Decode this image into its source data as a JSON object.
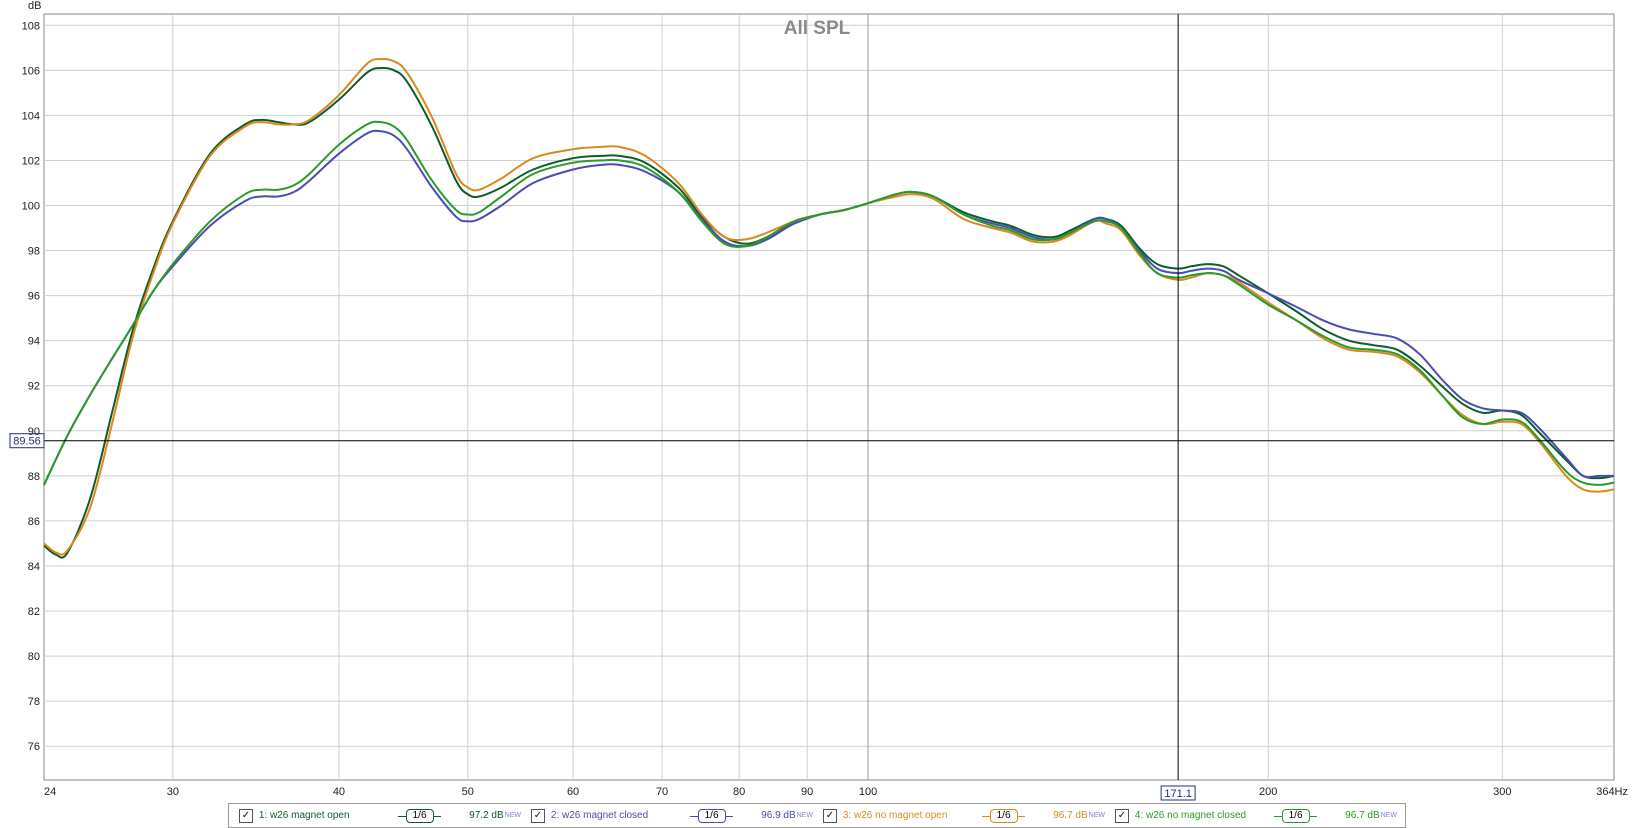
{
  "chart_data": {
    "type": "line",
    "title": "All SPL",
    "xlabel": "Hz",
    "ylabel": "dB",
    "xscale": "log",
    "xlim": [
      24,
      364
    ],
    "ylim": [
      74.5,
      108.5
    ],
    "xticks": [
      24,
      30,
      40,
      50,
      60,
      70,
      80,
      90,
      100,
      200,
      300,
      364
    ],
    "xtick_labels": [
      "24",
      "30",
      "40",
      "50",
      "60",
      "70",
      "80",
      "90",
      "100",
      "200",
      "300",
      "364Hz"
    ],
    "yticks": [
      76,
      78,
      80,
      82,
      84,
      86,
      88,
      90,
      92,
      94,
      96,
      98,
      100,
      102,
      104,
      106,
      108
    ],
    "grid": true,
    "legend_position": "bottom",
    "cursor": {
      "x": 171.1,
      "x_label": "171.1",
      "y": 89.56,
      "y_label": "89.56"
    },
    "series": [
      {
        "name": "1: w26 magnet open",
        "color": "#0d5c2a",
        "points": [
          [
            24,
            84.9
          ],
          [
            24.5,
            84.5
          ],
          [
            25,
            84.6
          ],
          [
            26,
            87
          ],
          [
            27,
            90.8
          ],
          [
            28,
            94.5
          ],
          [
            29,
            97.2
          ],
          [
            30,
            99.3
          ],
          [
            32,
            102.3
          ],
          [
            34,
            103.6
          ],
          [
            35,
            103.8
          ],
          [
            36,
            103.7
          ],
          [
            37,
            103.6
          ],
          [
            38,
            103.7
          ],
          [
            40,
            104.7
          ],
          [
            42,
            105.9
          ],
          [
            43,
            106.1
          ],
          [
            44,
            106.0
          ],
          [
            45,
            105.5
          ],
          [
            47,
            103.5
          ],
          [
            49,
            101.1
          ],
          [
            50,
            100.5
          ],
          [
            51,
            100.4
          ],
          [
            53,
            100.8
          ],
          [
            56,
            101.6
          ],
          [
            60,
            102.1
          ],
          [
            63,
            102.2
          ],
          [
            65,
            102.2
          ],
          [
            68,
            101.9
          ],
          [
            72,
            100.8
          ],
          [
            75,
            99.5
          ],
          [
            78,
            98.6
          ],
          [
            81,
            98.3
          ],
          [
            84,
            98.6
          ],
          [
            88,
            99.2
          ],
          [
            92,
            99.6
          ],
          [
            96,
            99.8
          ],
          [
            100,
            100.1
          ],
          [
            105,
            100.5
          ],
          [
            108,
            100.6
          ],
          [
            112,
            100.4
          ],
          [
            118,
            99.7
          ],
          [
            124,
            99.3
          ],
          [
            128,
            99.1
          ],
          [
            133,
            98.7
          ],
          [
            138,
            98.6
          ],
          [
            142,
            98.9
          ],
          [
            148,
            99.4
          ],
          [
            151,
            99.4
          ],
          [
            155,
            99.1
          ],
          [
            160,
            98.1
          ],
          [
            165,
            97.4
          ],
          [
            171,
            97.2
          ],
          [
            175,
            97.3
          ],
          [
            180,
            97.4
          ],
          [
            185,
            97.3
          ],
          [
            190,
            96.9
          ],
          [
            200,
            96.1
          ],
          [
            210,
            95.3
          ],
          [
            220,
            94.5
          ],
          [
            230,
            94.0
          ],
          [
            240,
            93.8
          ],
          [
            250,
            93.6
          ],
          [
            260,
            92.9
          ],
          [
            270,
            92.0
          ],
          [
            280,
            91.2
          ],
          [
            290,
            90.8
          ],
          [
            300,
            90.9
          ],
          [
            310,
            90.7
          ],
          [
            320,
            89.9
          ],
          [
            335,
            88.7
          ],
          [
            345,
            88.0
          ],
          [
            355,
            87.9
          ],
          [
            364,
            88.0
          ]
        ]
      },
      {
        "name": "2: w26 magnet closed",
        "color": "#4a4cb3",
        "points": [
          [
            24,
            87.6
          ],
          [
            25,
            89.8
          ],
          [
            26,
            91.6
          ],
          [
            27,
            93.2
          ],
          [
            28,
            94.7
          ],
          [
            29,
            96.2
          ],
          [
            30,
            97.3
          ],
          [
            32,
            99.1
          ],
          [
            34,
            100.2
          ],
          [
            35,
            100.4
          ],
          [
            36,
            100.4
          ],
          [
            37,
            100.6
          ],
          [
            38,
            101.1
          ],
          [
            40,
            102.3
          ],
          [
            42,
            103.2
          ],
          [
            43,
            103.3
          ],
          [
            44,
            103.1
          ],
          [
            45,
            102.5
          ],
          [
            47,
            100.8
          ],
          [
            49,
            99.5
          ],
          [
            50,
            99.3
          ],
          [
            51,
            99.4
          ],
          [
            53,
            100.0
          ],
          [
            56,
            101.0
          ],
          [
            60,
            101.6
          ],
          [
            63,
            101.8
          ],
          [
            65,
            101.8
          ],
          [
            68,
            101.5
          ],
          [
            72,
            100.6
          ],
          [
            75,
            99.4
          ],
          [
            78,
            98.4
          ],
          [
            81,
            98.2
          ],
          [
            84,
            98.5
          ],
          [
            88,
            99.2
          ],
          [
            92,
            99.6
          ],
          [
            96,
            99.8
          ],
          [
            100,
            100.1
          ],
          [
            105,
            100.5
          ],
          [
            108,
            100.6
          ],
          [
            112,
            100.4
          ],
          [
            118,
            99.6
          ],
          [
            124,
            99.2
          ],
          [
            128,
            99.0
          ],
          [
            133,
            98.6
          ],
          [
            138,
            98.5
          ],
          [
            142,
            98.8
          ],
          [
            148,
            99.4
          ],
          [
            151,
            99.4
          ],
          [
            155,
            99.0
          ],
          [
            160,
            98.0
          ],
          [
            165,
            97.2
          ],
          [
            171,
            97.0
          ],
          [
            175,
            97.1
          ],
          [
            180,
            97.2
          ],
          [
            185,
            97.1
          ],
          [
            190,
            96.7
          ],
          [
            200,
            96.1
          ],
          [
            210,
            95.5
          ],
          [
            220,
            94.9
          ],
          [
            230,
            94.5
          ],
          [
            240,
            94.3
          ],
          [
            250,
            94.1
          ],
          [
            260,
            93.4
          ],
          [
            270,
            92.3
          ],
          [
            280,
            91.4
          ],
          [
            290,
            91.0
          ],
          [
            300,
            90.9
          ],
          [
            310,
            90.8
          ],
          [
            320,
            90.1
          ],
          [
            335,
            88.8
          ],
          [
            345,
            88.0
          ],
          [
            355,
            88.0
          ],
          [
            364,
            88.0
          ]
        ]
      },
      {
        "name": "3: w26 no magnet open",
        "color": "#d98a1e",
        "points": [
          [
            24,
            85.0
          ],
          [
            24.5,
            84.6
          ],
          [
            25,
            84.7
          ],
          [
            26,
            86.6
          ],
          [
            27,
            90.3
          ],
          [
            28,
            94.2
          ],
          [
            29,
            97.0
          ],
          [
            30,
            99.2
          ],
          [
            32,
            102.2
          ],
          [
            34,
            103.5
          ],
          [
            35,
            103.7
          ],
          [
            36,
            103.6
          ],
          [
            37,
            103.6
          ],
          [
            38,
            103.8
          ],
          [
            40,
            104.9
          ],
          [
            42,
            106.3
          ],
          [
            43,
            106.5
          ],
          [
            44,
            106.4
          ],
          [
            45,
            105.9
          ],
          [
            47,
            103.9
          ],
          [
            49,
            101.4
          ],
          [
            50,
            100.8
          ],
          [
            51,
            100.7
          ],
          [
            53,
            101.2
          ],
          [
            56,
            102.1
          ],
          [
            60,
            102.5
          ],
          [
            63,
            102.6
          ],
          [
            65,
            102.6
          ],
          [
            68,
            102.2
          ],
          [
            72,
            101.0
          ],
          [
            75,
            99.6
          ],
          [
            78,
            98.6
          ],
          [
            81,
            98.5
          ],
          [
            84,
            98.8
          ],
          [
            88,
            99.3
          ],
          [
            92,
            99.6
          ],
          [
            96,
            99.8
          ],
          [
            100,
            100.1
          ],
          [
            105,
            100.4
          ],
          [
            108,
            100.5
          ],
          [
            112,
            100.3
          ],
          [
            118,
            99.4
          ],
          [
            124,
            99.0
          ],
          [
            128,
            98.8
          ],
          [
            133,
            98.4
          ],
          [
            138,
            98.4
          ],
          [
            142,
            98.7
          ],
          [
            148,
            99.3
          ],
          [
            151,
            99.2
          ],
          [
            155,
            98.9
          ],
          [
            160,
            97.8
          ],
          [
            165,
            97.0
          ],
          [
            171,
            96.7
          ],
          [
            175,
            96.8
          ],
          [
            180,
            97.0
          ],
          [
            185,
            96.9
          ],
          [
            190,
            96.6
          ],
          [
            200,
            95.7
          ],
          [
            210,
            94.9
          ],
          [
            220,
            94.1
          ],
          [
            230,
            93.6
          ],
          [
            240,
            93.5
          ],
          [
            250,
            93.3
          ],
          [
            260,
            92.6
          ],
          [
            270,
            91.6
          ],
          [
            280,
            90.7
          ],
          [
            290,
            90.3
          ],
          [
            300,
            90.4
          ],
          [
            310,
            90.3
          ],
          [
            320,
            89.5
          ],
          [
            335,
            88.0
          ],
          [
            345,
            87.4
          ],
          [
            355,
            87.3
          ],
          [
            364,
            87.4
          ]
        ]
      },
      {
        "name": "4: w26 no magnet closed",
        "color": "#2a9a2a",
        "points": [
          [
            24,
            87.6
          ],
          [
            25,
            89.8
          ],
          [
            26,
            91.6
          ],
          [
            27,
            93.2
          ],
          [
            28,
            94.7
          ],
          [
            29,
            96.2
          ],
          [
            30,
            97.4
          ],
          [
            32,
            99.3
          ],
          [
            34,
            100.5
          ],
          [
            35,
            100.7
          ],
          [
            36,
            100.7
          ],
          [
            37,
            100.9
          ],
          [
            38,
            101.4
          ],
          [
            40,
            102.7
          ],
          [
            42,
            103.6
          ],
          [
            43,
            103.7
          ],
          [
            44,
            103.5
          ],
          [
            45,
            102.9
          ],
          [
            47,
            101.1
          ],
          [
            49,
            99.8
          ],
          [
            50,
            99.6
          ],
          [
            51,
            99.7
          ],
          [
            53,
            100.4
          ],
          [
            56,
            101.4
          ],
          [
            60,
            101.9
          ],
          [
            63,
            102.0
          ],
          [
            65,
            102.0
          ],
          [
            68,
            101.7
          ],
          [
            72,
            100.6
          ],
          [
            75,
            99.3
          ],
          [
            78,
            98.3
          ],
          [
            81,
            98.2
          ],
          [
            84,
            98.6
          ],
          [
            88,
            99.3
          ],
          [
            92,
            99.6
          ],
          [
            96,
            99.8
          ],
          [
            100,
            100.1
          ],
          [
            105,
            100.5
          ],
          [
            108,
            100.6
          ],
          [
            112,
            100.4
          ],
          [
            118,
            99.6
          ],
          [
            124,
            99.1
          ],
          [
            128,
            98.9
          ],
          [
            133,
            98.5
          ],
          [
            138,
            98.5
          ],
          [
            142,
            98.8
          ],
          [
            148,
            99.3
          ],
          [
            151,
            99.3
          ],
          [
            155,
            99.0
          ],
          [
            160,
            97.9
          ],
          [
            165,
            97.0
          ],
          [
            171,
            96.8
          ],
          [
            175,
            96.9
          ],
          [
            180,
            97.0
          ],
          [
            185,
            96.9
          ],
          [
            190,
            96.5
          ],
          [
            200,
            95.6
          ],
          [
            210,
            94.9
          ],
          [
            220,
            94.2
          ],
          [
            230,
            93.7
          ],
          [
            240,
            93.6
          ],
          [
            250,
            93.4
          ],
          [
            260,
            92.7
          ],
          [
            270,
            91.6
          ],
          [
            280,
            90.6
          ],
          [
            290,
            90.3
          ],
          [
            300,
            90.5
          ],
          [
            310,
            90.4
          ],
          [
            320,
            89.6
          ],
          [
            335,
            88.2
          ],
          [
            345,
            87.7
          ],
          [
            355,
            87.6
          ],
          [
            364,
            87.7
          ]
        ]
      }
    ]
  },
  "legend": [
    {
      "checkbox": "✓",
      "label": "1: w26 magnet open",
      "smoothing": "1/6",
      "value": "97.2 dB",
      "badge": "NEW",
      "color": "#0d5c2a"
    },
    {
      "checkbox": "✓",
      "label": "2: w26 magnet closed",
      "smoothing": "1/6",
      "value": "96.9 dB",
      "badge": "NEW",
      "color": "#4a4cb3"
    },
    {
      "checkbox": "✓",
      "label": "3: w26 no magnet open",
      "smoothing": "1/6",
      "value": "96.7 dB",
      "badge": "NEW",
      "color": "#d98a1e"
    },
    {
      "checkbox": "✓",
      "label": "4: w26 no magnet closed",
      "smoothing": "1/6",
      "value": "96.7 dB",
      "badge": "NEW",
      "color": "#2a9a2a"
    }
  ]
}
